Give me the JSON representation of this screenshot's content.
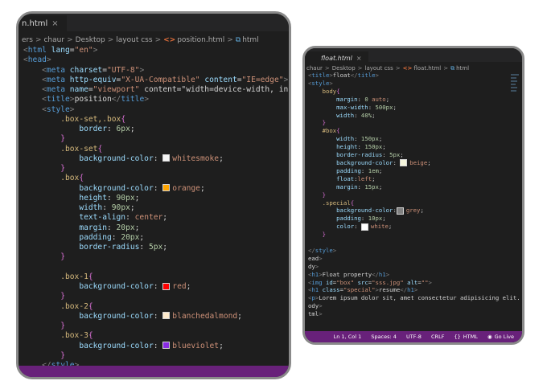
{
  "left_editor": {
    "tab_label": "n.html",
    "tab_close": "×",
    "breadcrumb": [
      "ers",
      "chaur",
      "Desktop",
      "layout css",
      "position.html",
      "html"
    ],
    "code_lines": [
      "<html lang=\"en\">",
      "<head>",
      "    <meta charset=\"UTF-8\">",
      "    <meta http-equiv=\"X-UA-Compatible\" content=\"IE=edge\">",
      "    <meta name=\"viewport\" content=\"width=device-width, initial-sca",
      "    <title>position</title>",
      "    <style>",
      "        .box-set,.box{",
      "            border: 6px;",
      "        }",
      "        .box-set{",
      "            background-color: whitesmoke;",
      "        }",
      "        .box{",
      "            background-color: orange;",
      "            height: 90px;",
      "            width: 90px;",
      "            text-align: center;",
      "            margin: 20px;",
      "            padding: 20px;",
      "            border-radius: 5px;",
      "        }",
      "",
      "        .box-1{",
      "            background-color: red;",
      "        }",
      "        .box-2{",
      "            background-color: blanchedalmond;",
      "        }",
      "        .box-3{",
      "            background-color: blueviolet;",
      "        }",
      "    </style>"
    ]
  },
  "right_editor": {
    "tab_label": "float.html",
    "tab_close": "×",
    "breadcrumb": [
      "chaur",
      "Desktop",
      "layout css",
      "float.html",
      "html"
    ],
    "code_lines": [
      "<title>float</title>",
      "<style>",
      "    body{",
      "        margin: 0 auto;",
      "        max-width: 500px;",
      "        width: 40%;",
      "    }",
      "    #box{",
      "        width: 150px;",
      "        height: 150px;",
      "        border-radius: 5px;",
      "        background-color: beige;",
      "        padding: 1em;",
      "        float:left;",
      "        margin: 15px;",
      "    }",
      "    .special{",
      "        background-color:grey;",
      "        padding: 10px;",
      "        color: white;",
      "    }",
      "",
      "</style>",
      "ead>",
      "dy>",
      "<h1>Float property</h1>",
      "<img id=\"box\" src=\"sss.jpg\" alt=\"\">",
      "<h1 class=\"special\">resume</h1>",
      "<p>Lorem ipsum dolor sit, amet consectetur adipisicing elit.",
      "ody>",
      "tml>"
    ],
    "status": {
      "position": "Ln 1, Col 1",
      "spaces": "Spaces: 4",
      "encoding": "UTF-8",
      "eol": "CRLF",
      "language": "HTML",
      "live": "Go Live"
    }
  },
  "colors": {
    "whitesmoke": "#f5f5f5",
    "orange": "#ffa500",
    "red": "#ff0000",
    "blanchedalmond": "#ffebcd",
    "blueviolet": "#8a2be2",
    "beige": "#f5f5dc",
    "grey": "#808080",
    "white": "#ffffff",
    "status_bar": "#68217a"
  }
}
